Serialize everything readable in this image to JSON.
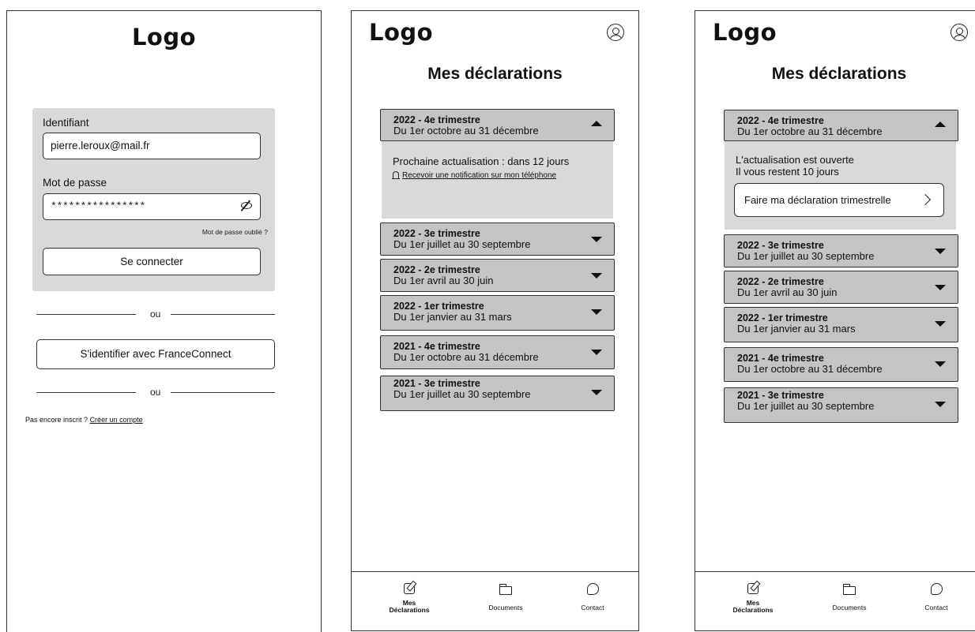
{
  "logo_text": "Logo",
  "login": {
    "identifier_label": "Identifiant",
    "identifier_value": "pierre.leroux@mail.fr",
    "password_label": "Mot de passe",
    "password_value": "****************",
    "forgot_password": "Mot de passe oublié ?",
    "connect_button": "Se connecter",
    "separator_1": "ou",
    "franceconnect_button": "S'identifier avec FranceConnect",
    "separator_2": "ou",
    "signup_prefix": "Pas encore inscrit ?",
    "signup_link": "Créer un compte"
  },
  "declarations": {
    "page_title": "Mes déclarations",
    "items": [
      {
        "title": "2022 - 4e trimestre",
        "range": "Du 1er octobre au 31 décembre"
      },
      {
        "title": "2022 - 3e trimestre",
        "range": "Du 1er juillet au 30 septembre"
      },
      {
        "title": "2022 - 2e trimestre",
        "range": "Du 1er avril au 30 juin"
      },
      {
        "title": "2022 - 1er trimestre",
        "range": "Du 1er janvier au 31 mars"
      },
      {
        "title": "2021 - 4e trimestre",
        "range": "Du 1er octobre au 31 décembre"
      },
      {
        "title": "2021 - 3e trimestre",
        "range": "Du 1er juillet au 30 septembre"
      }
    ],
    "screen2_panel": {
      "next_update": "Prochaine actualisation : dans 12 jours",
      "notification_link": "Recevoir une notification sur mon téléphone"
    },
    "screen3_panel": {
      "open_line1": "L'actualisation est ouverte",
      "open_line2": "Il vous restent 10 jours",
      "declare_button": "Faire ma déclaration trimestrelle"
    }
  },
  "nav": {
    "declarations_line1": "Mes",
    "declarations_line2": "Déclarations",
    "documents": "Documents",
    "contact": "Contact"
  },
  "icons": [
    "account-icon",
    "eye-off-icon",
    "bell-icon",
    "chevron-right-icon",
    "pencil-icon",
    "folder-icon",
    "chat-icon"
  ]
}
